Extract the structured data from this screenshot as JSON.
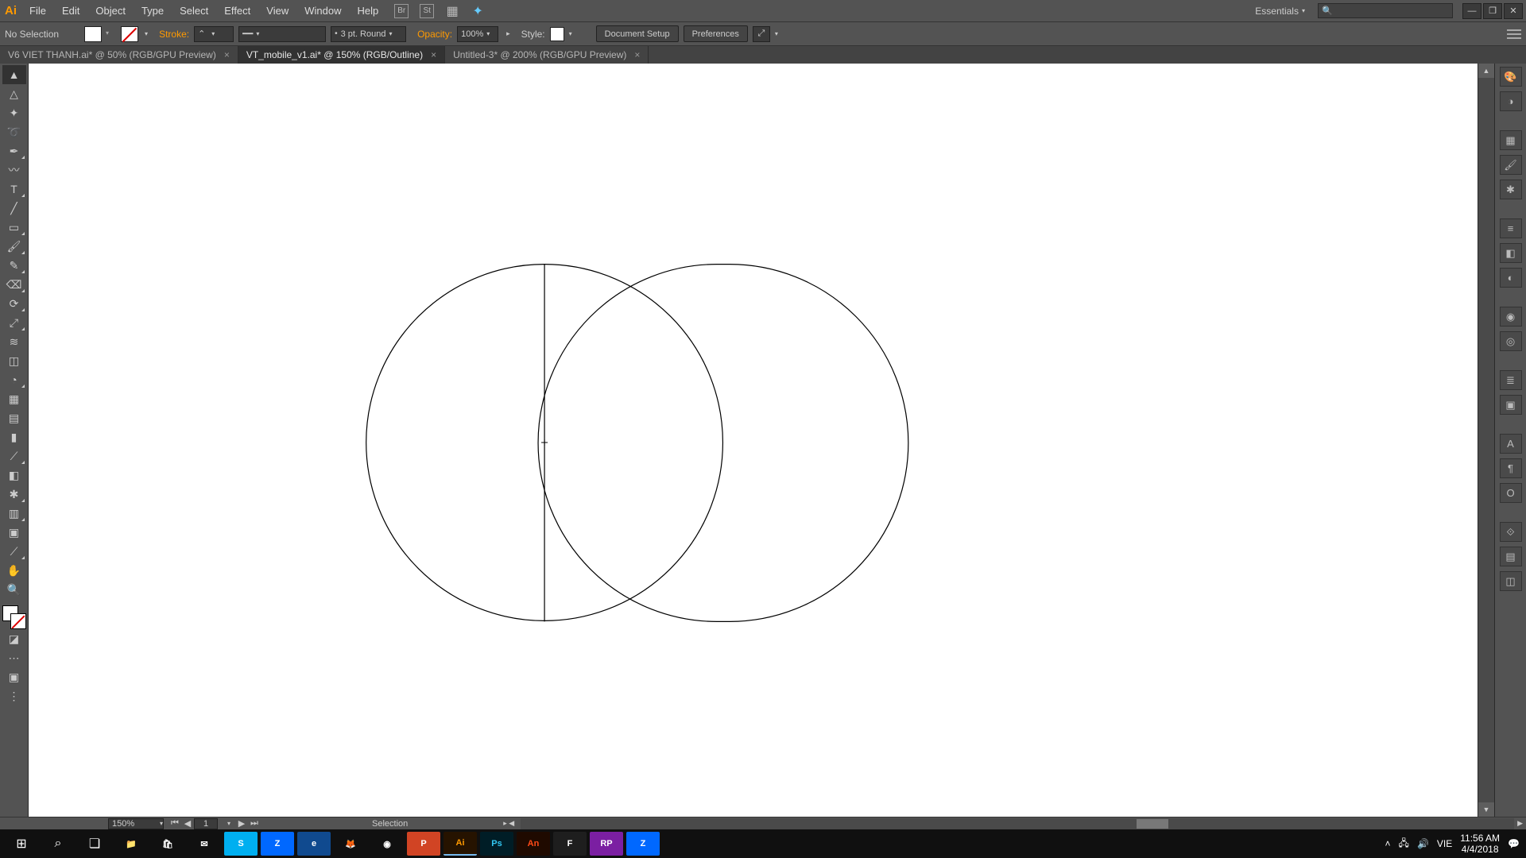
{
  "app": {
    "name": "Ai"
  },
  "menus": [
    "File",
    "Edit",
    "Object",
    "Type",
    "Select",
    "Effect",
    "View",
    "Window",
    "Help"
  ],
  "menubar_icons": [
    "Br",
    "St",
    "grid",
    "touch"
  ],
  "workspace": {
    "label": "Essentials"
  },
  "window_buttons": {
    "min": "—",
    "max": "❐",
    "close": "✕"
  },
  "control": {
    "selection": "No Selection",
    "stroke_label": "Stroke:",
    "stroke_weight": "",
    "brush_profile": "3 pt. Round",
    "opacity_label": "Opacity:",
    "opacity_value": "100%",
    "style_label": "Style:",
    "doc_setup": "Document Setup",
    "preferences": "Preferences"
  },
  "tabs": [
    {
      "label": "V6 VIET THANH.ai* @ 50% (RGB/GPU Preview)",
      "active": false
    },
    {
      "label": "VT_mobile_v1.ai* @ 150% (RGB/Outline)",
      "active": true
    },
    {
      "label": "Untitled-3* @ 200% (RGB/GPU Preview)",
      "active": false
    }
  ],
  "tools": [
    "selection",
    "direct-selection",
    "magic-wand",
    "lasso",
    "pen",
    "curvature",
    "type",
    "line",
    "rectangle",
    "brush",
    "pencil",
    "eraser",
    "rotate",
    "scale",
    "width",
    "free-transform",
    "shape-builder",
    "perspective",
    "mesh",
    "gradient",
    "eyedropper",
    "blend",
    "symbol-sprayer",
    "column-graph",
    "artboard",
    "slice",
    "hand",
    "zoom"
  ],
  "right_dock_groups": [
    [
      "color",
      "color-guide"
    ],
    [
      "swatches",
      "brushes",
      "symbols"
    ],
    [
      "stroke",
      "gradient",
      "transparency"
    ],
    [
      "appearance",
      "graphic-styles"
    ],
    [
      "layers",
      "artboards"
    ],
    [
      "character",
      "paragraph",
      "opentype"
    ],
    [
      "transform",
      "align",
      "pathfinder"
    ]
  ],
  "status": {
    "zoom": "150%",
    "page": "1",
    "tool": "Selection"
  },
  "taskbar": {
    "apps": [
      {
        "name": "start",
        "glyph": "⊞",
        "bg": "",
        "active": false
      },
      {
        "name": "search",
        "glyph": "⌕",
        "bg": "",
        "active": false
      },
      {
        "name": "taskview",
        "glyph": "❏",
        "bg": "",
        "active": false
      },
      {
        "name": "explorer",
        "glyph": "📁",
        "bg": "",
        "active": false
      },
      {
        "name": "store",
        "glyph": "🛍",
        "bg": "",
        "active": false
      },
      {
        "name": "mail",
        "glyph": "✉",
        "bg": "",
        "active": false
      },
      {
        "name": "skype",
        "glyph": "S",
        "bg": "#00aff0",
        "active": false
      },
      {
        "name": "zalo",
        "glyph": "Z",
        "bg": "#0068ff",
        "active": false
      },
      {
        "name": "edge",
        "glyph": "e",
        "bg": "#104a8f",
        "active": false
      },
      {
        "name": "firefox",
        "glyph": "🦊",
        "bg": "",
        "active": false
      },
      {
        "name": "chrome",
        "glyph": "◉",
        "bg": "",
        "active": false
      },
      {
        "name": "ppt",
        "glyph": "P",
        "bg": "#d14424",
        "active": false
      },
      {
        "name": "illustrator",
        "glyph": "Ai",
        "bg": "#261300",
        "color": "#ff9a00",
        "active": true
      },
      {
        "name": "photoshop",
        "glyph": "Ps",
        "bg": "#001d26",
        "color": "#31c5f0",
        "active": false
      },
      {
        "name": "animate",
        "glyph": "An",
        "bg": "#1f0a00",
        "color": "#ff4a17",
        "active": false
      },
      {
        "name": "figma",
        "glyph": "F",
        "bg": "#1e1e1e",
        "active": false
      },
      {
        "name": "axure",
        "glyph": "RP",
        "bg": "#7b1fa2",
        "active": false
      },
      {
        "name": "zalo2",
        "glyph": "Z",
        "bg": "#0068ff",
        "active": false
      }
    ],
    "tray": {
      "ime": "VIE",
      "time": "11:56 AM",
      "date": "4/4/2018"
    }
  }
}
